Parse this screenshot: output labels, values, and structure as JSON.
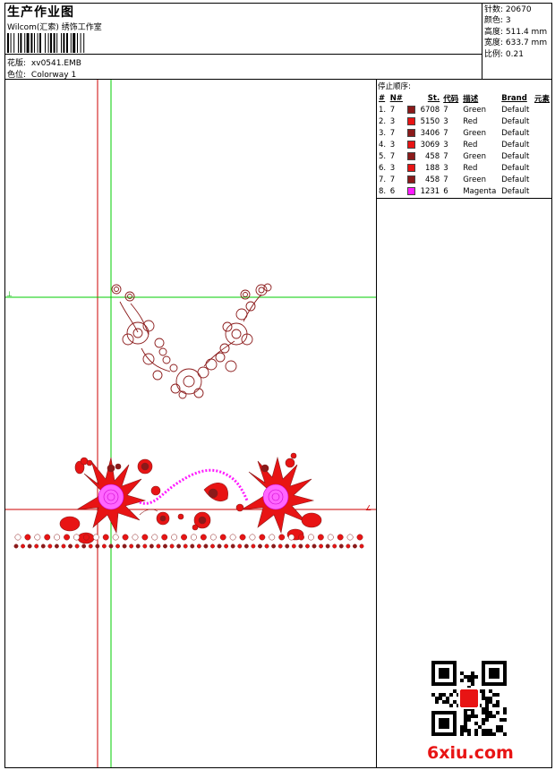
{
  "header": {
    "title": "生产作业图",
    "company": "Wilcom(汇索) 绣饰工作室",
    "pattern_label": "花版:",
    "pattern_value": "xv0541.EMB",
    "colorway_label": "色位:",
    "colorway_value": "Colorway 1"
  },
  "stats": [
    {
      "label": "针数:",
      "value": "20670"
    },
    {
      "label": "颜色:",
      "value": "3"
    },
    {
      "label": "高度:",
      "value": "511.4 mm"
    },
    {
      "label": "宽度:",
      "value": "633.7 mm"
    },
    {
      "label": "比例:",
      "value": "0.21"
    }
  ],
  "stop_sequence": {
    "caption": "停止顺序:",
    "columns": [
      "#",
      "N#",
      "St.",
      "代码",
      "描述",
      "Brand",
      "元素"
    ],
    "rows": [
      {
        "idx": "1.",
        "needle": "7",
        "color": "#8B1A1A",
        "stitches": "6708",
        "code": "7",
        "desc": "Green",
        "brand": "Default"
      },
      {
        "idx": "2.",
        "needle": "3",
        "color": "#E81414",
        "stitches": "5150",
        "code": "3",
        "desc": "Red",
        "brand": "Default"
      },
      {
        "idx": "3.",
        "needle": "7",
        "color": "#8B1A1A",
        "stitches": "3406",
        "code": "7",
        "desc": "Green",
        "brand": "Default"
      },
      {
        "idx": "4.",
        "needle": "3",
        "color": "#E81414",
        "stitches": "3069",
        "code": "3",
        "desc": "Red",
        "brand": "Default"
      },
      {
        "idx": "5.",
        "needle": "7",
        "color": "#8B1A1A",
        "stitches": "458",
        "code": "7",
        "desc": "Green",
        "brand": "Default"
      },
      {
        "idx": "6.",
        "needle": "3",
        "color": "#E81414",
        "stitches": "188",
        "code": "3",
        "desc": "Red",
        "brand": "Default"
      },
      {
        "idx": "7.",
        "needle": "7",
        "color": "#8B1A1A",
        "stitches": "458",
        "code": "7",
        "desc": "Green",
        "brand": "Default"
      },
      {
        "idx": "8.",
        "needle": "6",
        "color": "#FF1AFF",
        "stitches": "1231",
        "code": "6",
        "desc": "Magenta",
        "brand": "Default"
      }
    ]
  },
  "watermark": "6xiu.com",
  "colors": {
    "thread_dark_red": "#8B1A1A",
    "thread_red": "#E81414",
    "thread_magenta": "#FF1AFF",
    "guide_green": "#00CC00",
    "guide_red": "#CC0000"
  }
}
